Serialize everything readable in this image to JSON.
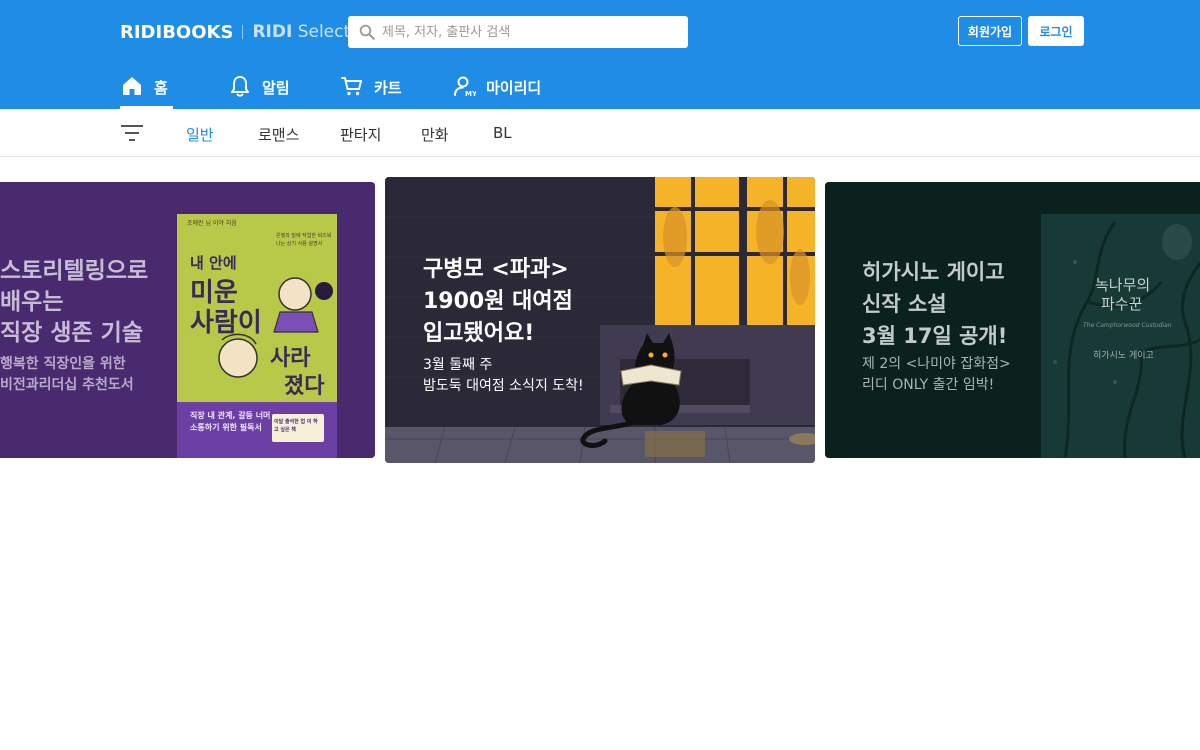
{
  "header": {
    "logo_main": "RIDIBOOKS",
    "logo_select_bold": "RIDI",
    "logo_select": "Select",
    "search_placeholder": "제목, 저자, 출판사 검색",
    "signup_label": "회원가입",
    "login_label": "로그인",
    "brand_color": "#1f8ce6"
  },
  "gnb": {
    "items": [
      {
        "label": "홈",
        "icon": "home-icon",
        "active": true
      },
      {
        "label": "알림",
        "icon": "bell-icon"
      },
      {
        "label": "카트",
        "icon": "cart-icon"
      },
      {
        "label": "마이리디",
        "icon": "my-ridi-icon"
      }
    ]
  },
  "categories": {
    "menu_icon": "filter-menu-icon",
    "tabs": [
      {
        "label": "일반",
        "active": true
      },
      {
        "label": "로맨스"
      },
      {
        "label": "판타지"
      },
      {
        "label": "만화"
      },
      {
        "label": "BL"
      }
    ]
  },
  "banners": [
    {
      "title_lines": [
        "스토리텔링으로",
        "배우는",
        "직장 생존 기술"
      ],
      "sub_lines": [
        "행복한 직장인을 위한",
        "비전과리더십 추천도서"
      ],
      "book": {
        "top_small": "은행과 밑에 작업한 비즈북 나는 상기 사용 설명서",
        "author_small": "조에린 님 이야 지음",
        "title_lines": [
          "내 안에",
          "미운",
          "사람이",
          "사라",
          "졌다"
        ],
        "caption_lines": [
          "직장 내 관계, 갈등 너머",
          "소통하기 위한 필독서"
        ],
        "badge": "이달 출석한 업 이 하고 싶은 책"
      },
      "bg_color": "#4a2a6e"
    },
    {
      "title_lines": [
        "구병모 <파과>",
        "1900원 대여점",
        "입고됐어요!"
      ],
      "sub_lines": [
        "3월 둘째 주",
        "밤도둑 대여점 소식지 도착!"
      ],
      "bg_color": "#2b2838"
    },
    {
      "title_lines": [
        "히가시노 게이고",
        "신작 소설",
        "3월 17일 공개!"
      ],
      "sub_lines": [
        "제 2의 <나미야 잡화점>",
        "리디 ONLY 출간 임박!"
      ],
      "book": {
        "title_lines": [
          "녹나무의",
          "파수꾼"
        ],
        "subtitle": "The Camphorwood Custodian",
        "author": "히가시노 게이고"
      },
      "bg_color": "#0a211d"
    }
  ]
}
